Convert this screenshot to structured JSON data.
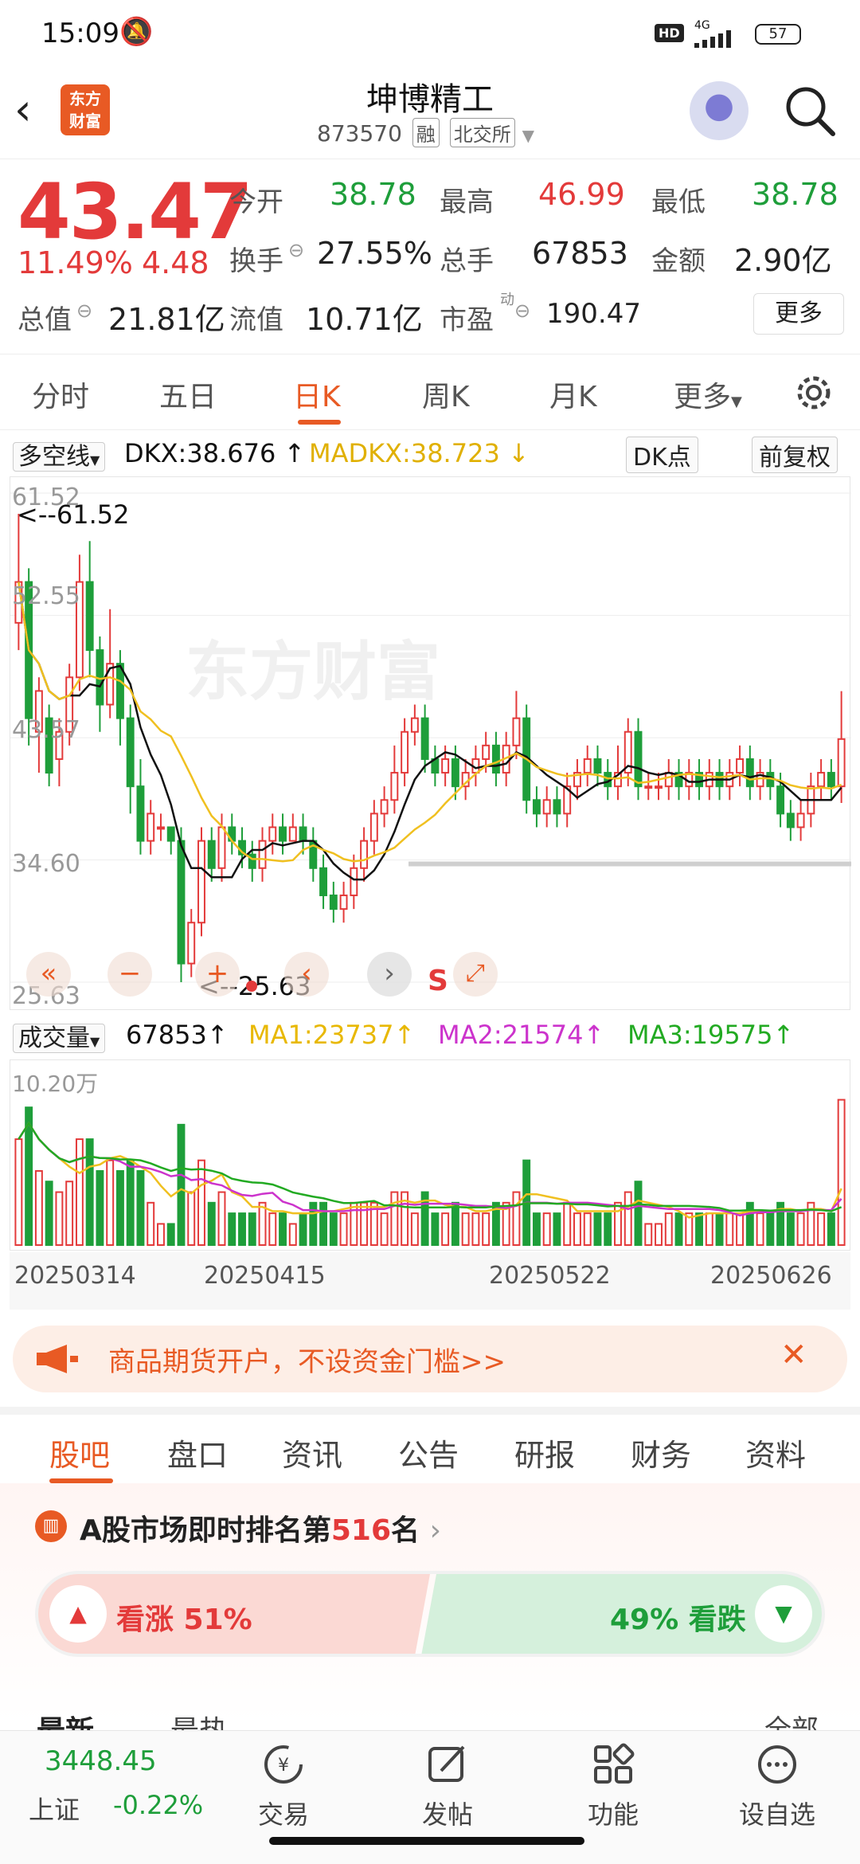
{
  "status_bar": {
    "time": "15:09",
    "hd": "HD",
    "network": "4G",
    "battery": "57"
  },
  "header": {
    "title": "坤博精工",
    "code": "873570",
    "tag1": "融",
    "tag2": "北交所",
    "logo_line1": "东方",
    "logo_line2": "财富"
  },
  "quote": {
    "price": "43.47",
    "change_pct": "11.49%",
    "change": "4.48",
    "open_label": "今开",
    "open": "38.78",
    "high_label": "最高",
    "high": "46.99",
    "low_label": "最低",
    "low": "38.78",
    "turnover_label": "换手",
    "turnover": "27.55%",
    "volume_label": "总手",
    "volume": "67853",
    "amount_label": "金额",
    "amount": "2.90亿",
    "mktcap_label": "总值",
    "mktcap": "21.81亿",
    "float_label": "流值",
    "float": "10.71亿",
    "pe_label": "市盈",
    "pe_sup": "动",
    "pe": "190.47",
    "more": "更多"
  },
  "period_tabs": [
    "分时",
    "五日",
    "日K",
    "周K",
    "月K",
    "更多"
  ],
  "active_period": "日K",
  "kline_indicator": {
    "select": "多空线",
    "dkx": "DKX:38.676",
    "madkx": "MADKX:38.723",
    "dk_button": "DK点",
    "adjust_button": "前复权"
  },
  "kline_axis": {
    "top": "61.52",
    "l2": "52.55",
    "l3": "43.57",
    "l4": "34.60",
    "bottom": "25.63",
    "max_marker": "<--61.52",
    "min_marker": "<--25.63",
    "s_marker": "S",
    "watermark": "东方财富"
  },
  "volume_indicator": {
    "select": "成交量",
    "vol": "67853",
    "ma1": "MA1:23737",
    "ma2": "MA2:21574",
    "ma3": "MA3:19575",
    "axis_top": "10.20万"
  },
  "x_dates": [
    "20250314",
    "20250415",
    "20250522",
    "20250626"
  ],
  "colors": {
    "up": "#e33a3a",
    "down": "#1e9e3a",
    "accent": "#e85a24",
    "ma_black": "#111111",
    "ma_yellow": "#f0c020",
    "ma_magenta": "#cc33cc",
    "ma_green": "#22aa22"
  },
  "chart_data": {
    "type": "candlestick",
    "price_range": [
      25.63,
      61.52
    ],
    "candles": [
      [
        52,
        55,
        60,
        50
      ],
      [
        55,
        45,
        56,
        43
      ],
      [
        44,
        47,
        48,
        41
      ],
      [
        45,
        41,
        46,
        40
      ],
      [
        42,
        44,
        45,
        40
      ],
      [
        44,
        48,
        49,
        43
      ],
      [
        48,
        55,
        57,
        47
      ],
      [
        55,
        50,
        58,
        48
      ],
      [
        50,
        46,
        51,
        44
      ],
      [
        46,
        49,
        53,
        45
      ],
      [
        49,
        45,
        50,
        43
      ],
      [
        45,
        40,
        46,
        38
      ],
      [
        40,
        36,
        42,
        35
      ],
      [
        36,
        38,
        39,
        35
      ],
      [
        37,
        37,
        38,
        36
      ],
      [
        37,
        36,
        37,
        35
      ],
      [
        36,
        27,
        37,
        25.63
      ],
      [
        27,
        30,
        31,
        26
      ],
      [
        30,
        36,
        37,
        29
      ],
      [
        36,
        34,
        37,
        33
      ],
      [
        34,
        37,
        38,
        33
      ],
      [
        37,
        36,
        38,
        35
      ],
      [
        36,
        35,
        37,
        34
      ],
      [
        35,
        34,
        36,
        33
      ],
      [
        34,
        36,
        37,
        33
      ],
      [
        36,
        37,
        38,
        35
      ],
      [
        37,
        36,
        38,
        35
      ],
      [
        36,
        37,
        38,
        36
      ],
      [
        37,
        36,
        38,
        35
      ],
      [
        36,
        34,
        37,
        33
      ],
      [
        34,
        32,
        35,
        31
      ],
      [
        32,
        31,
        33,
        30
      ],
      [
        31,
        32,
        33,
        30
      ],
      [
        32,
        34,
        35,
        31
      ],
      [
        34,
        36,
        37,
        33
      ],
      [
        36,
        38,
        39,
        35
      ],
      [
        38,
        39,
        40,
        37
      ],
      [
        39,
        41,
        43,
        38
      ],
      [
        41,
        44,
        45,
        40
      ],
      [
        44,
        45,
        46,
        43
      ],
      [
        45,
        42,
        46,
        41
      ],
      [
        42,
        41,
        43,
        40
      ],
      [
        41,
        42,
        43,
        40
      ],
      [
        42,
        40,
        43,
        39
      ],
      [
        40,
        41,
        42,
        39
      ],
      [
        41,
        42,
        43,
        40
      ],
      [
        42,
        43,
        44,
        41
      ],
      [
        43,
        41,
        44,
        40
      ],
      [
        41,
        43,
        44,
        40
      ],
      [
        43,
        45,
        47,
        42
      ],
      [
        45,
        39,
        46,
        38
      ],
      [
        39,
        38,
        40,
        37
      ],
      [
        38,
        39,
        40,
        37
      ],
      [
        39,
        38,
        40,
        37
      ],
      [
        38,
        40,
        41,
        37
      ],
      [
        40,
        41,
        42,
        39
      ],
      [
        41,
        42,
        43,
        40
      ],
      [
        42,
        41,
        43,
        40
      ],
      [
        41,
        40,
        42,
        39
      ],
      [
        40,
        41,
        43,
        39
      ],
      [
        41,
        44,
        45,
        40
      ],
      [
        44,
        40,
        45,
        39
      ],
      [
        40,
        40,
        41,
        39
      ],
      [
        40,
        40,
        41,
        39
      ],
      [
        40,
        41,
        42,
        39
      ],
      [
        41,
        40,
        42,
        39
      ],
      [
        40,
        41,
        42,
        39
      ],
      [
        41,
        40,
        42,
        39
      ],
      [
        40,
        41,
        42,
        39
      ],
      [
        41,
        40,
        42,
        39
      ],
      [
        40,
        41,
        42,
        39
      ],
      [
        41,
        42,
        43,
        40
      ],
      [
        42,
        40,
        43,
        39
      ],
      [
        40,
        41,
        42,
        39
      ],
      [
        41,
        40,
        42,
        39
      ],
      [
        40,
        38,
        41,
        37
      ],
      [
        38,
        37,
        39,
        36
      ],
      [
        37,
        38,
        39,
        36
      ],
      [
        38,
        40,
        41,
        37
      ],
      [
        40,
        41,
        42,
        39
      ],
      [
        41,
        40,
        42,
        39
      ],
      [
        40,
        43.47,
        46.99,
        38.78
      ]
    ],
    "volume_max": 102000,
    "volume_last": 67853
  },
  "ad": {
    "text": "商品期货开户，不设资金门槛>>"
  },
  "lower_tabs": [
    "股吧",
    "盘口",
    "资讯",
    "公告",
    "研报",
    "财务",
    "资料"
  ],
  "rank": {
    "prefix": "A股市场即时排名第",
    "num": "516",
    "suffix": "名"
  },
  "vote": {
    "up": "看涨 51%",
    "down": "49% 看跌"
  },
  "feed": {
    "tab1": "最新",
    "tab2": "最热",
    "filter": "全部"
  },
  "bottom_bar": {
    "index_value": "3448.45",
    "index_name": "上证",
    "index_change": "-0.22%",
    "items": [
      "交易",
      "发帖",
      "功能",
      "设自选"
    ]
  }
}
